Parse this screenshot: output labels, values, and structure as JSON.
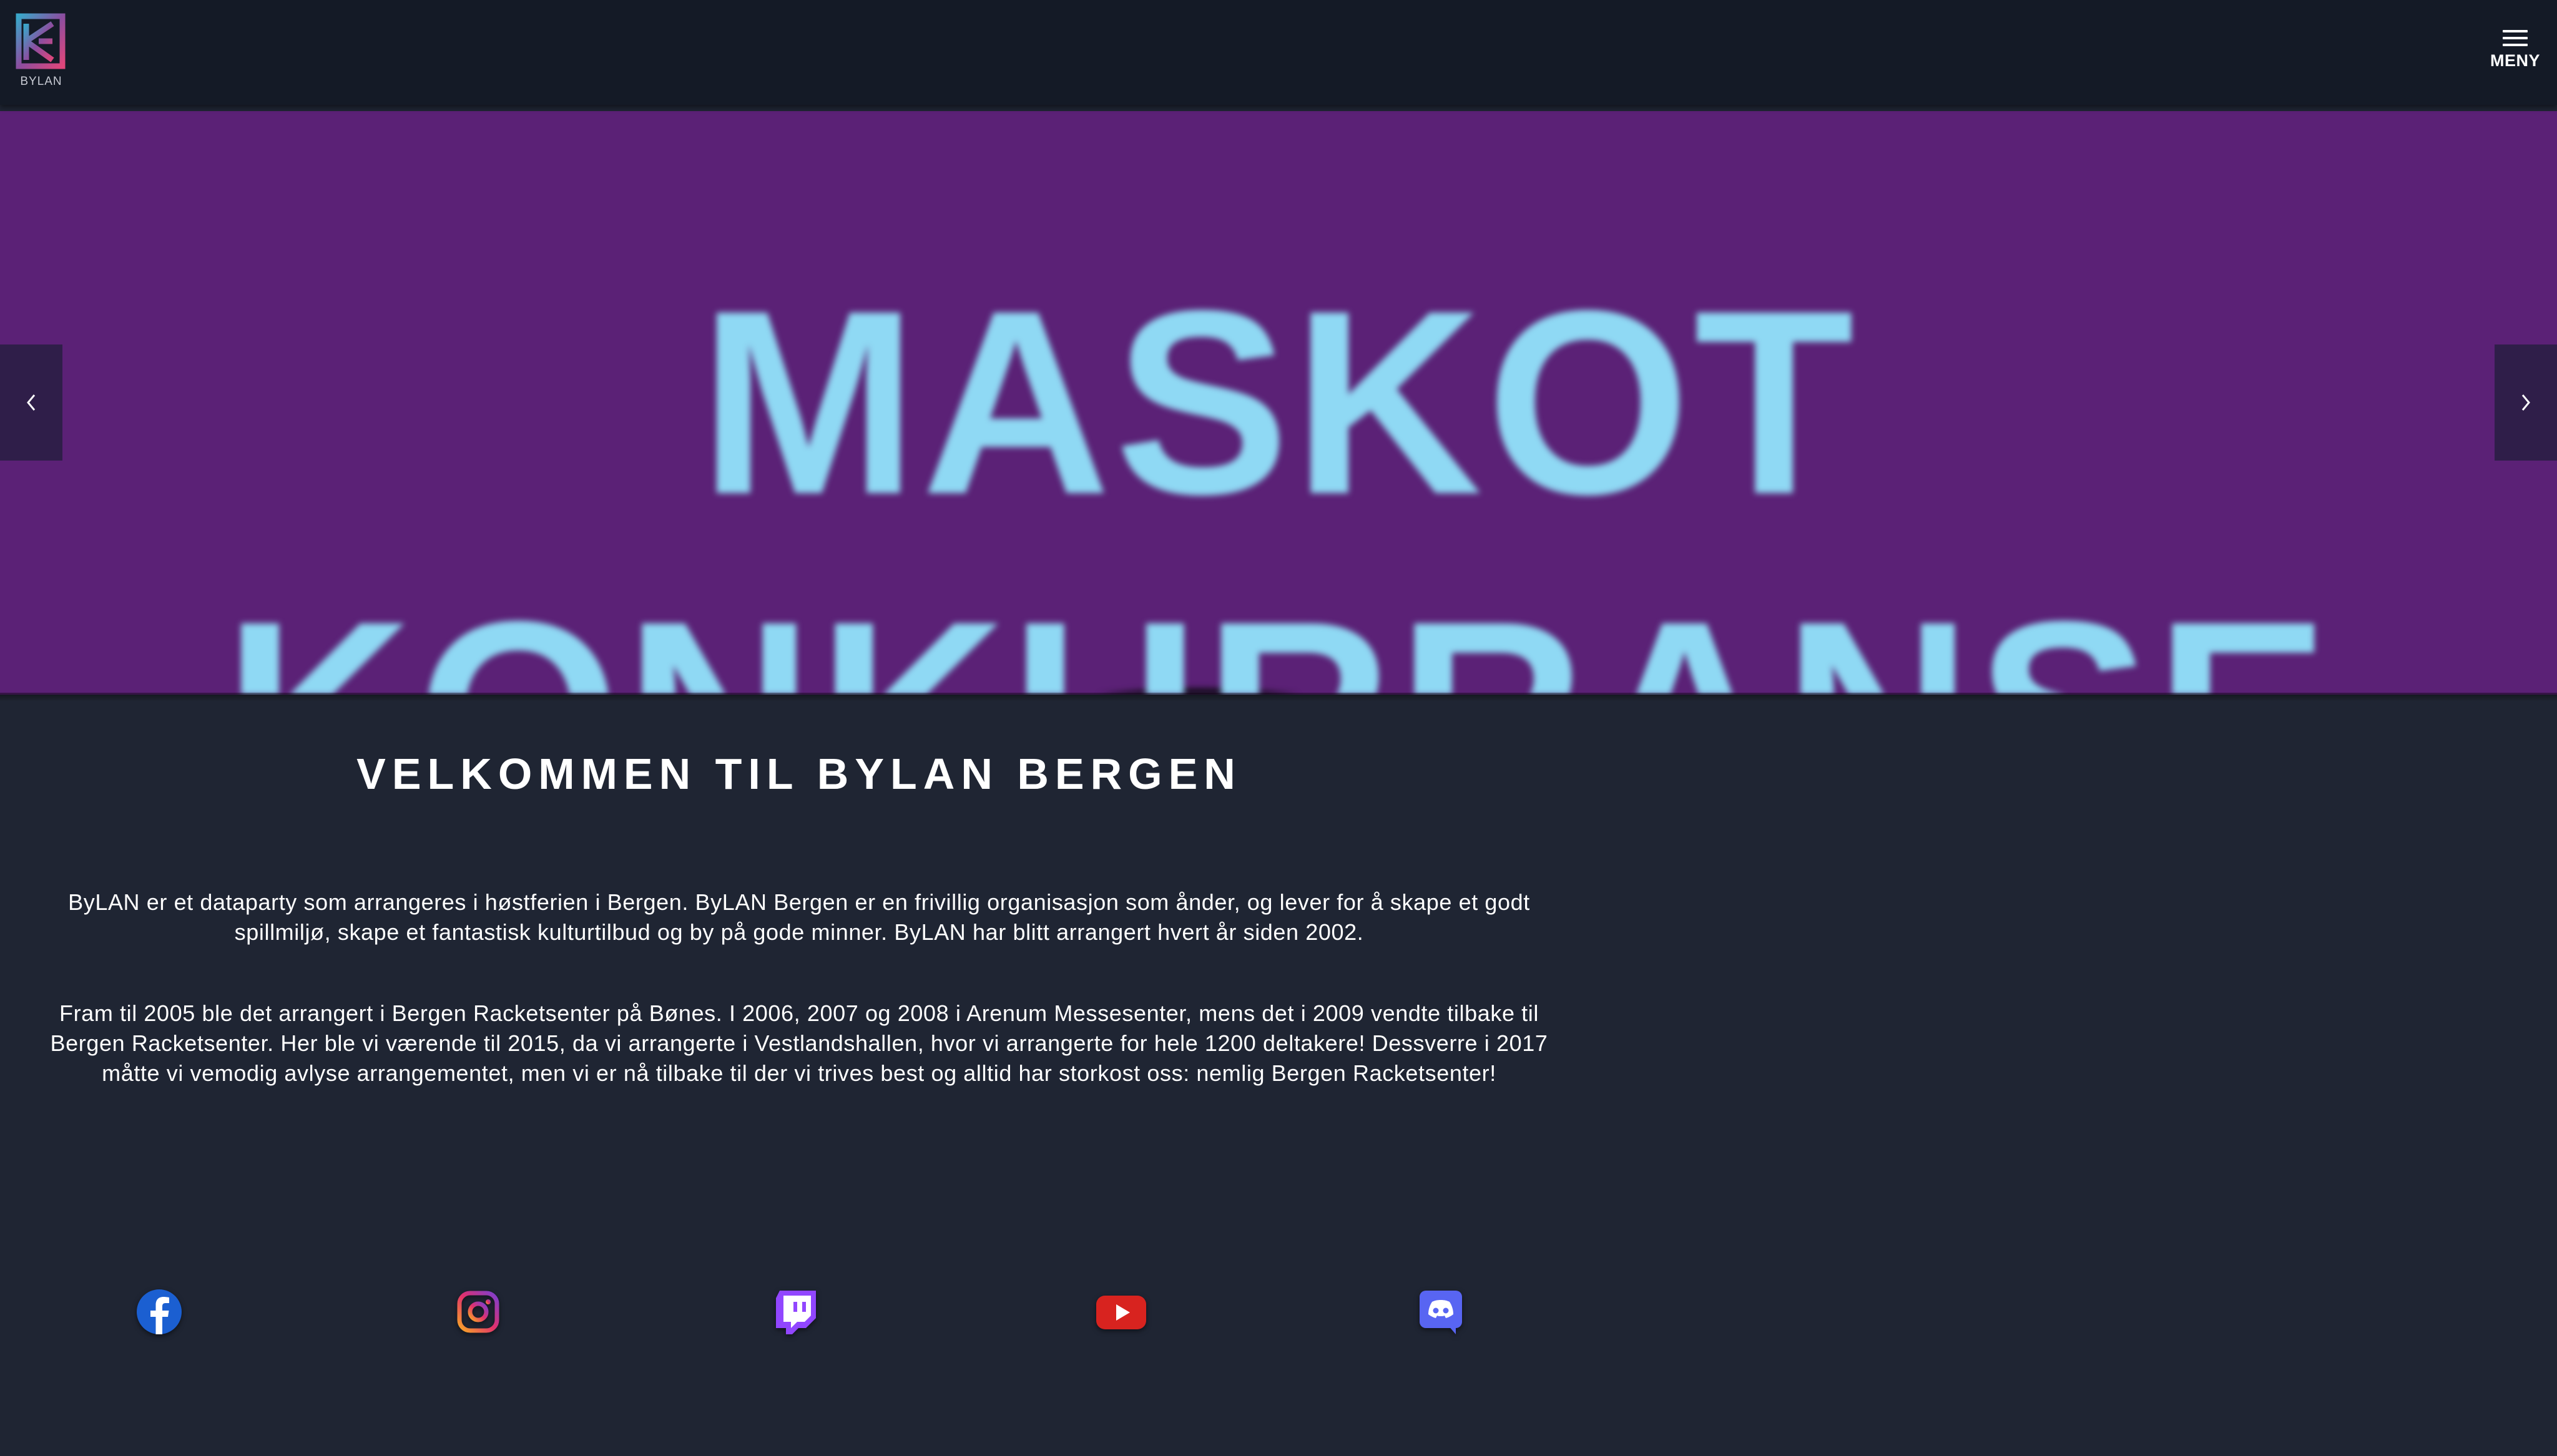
{
  "header": {
    "logo_text": "BYLAN",
    "menu_label": "MENY"
  },
  "hero": {
    "banner_line1": "MASKOT",
    "banner_line2": "KONKURRANSE",
    "colors": {
      "background": "#5b2176",
      "text": "#8fd9f4"
    }
  },
  "welcome": {
    "title": "VELKOMMEN TIL BYLAN BERGEN",
    "paragraph1": "ByLAN er et dataparty som arrangeres i høstferien i Bergen. ByLAN Bergen er en frivillig organisasjon som ånder, og lever for å skape et godt spillmiljø, skape et fantastisk kulturtilbud og by på gode minner. ByLAN har blitt arrangert hvert år siden 2002.",
    "paragraph2": "Fram til 2005 ble det arrangert i Bergen Racketsenter på Bønes. I 2006, 2007 og 2008 i Arenum Messesenter, mens det i 2009 vendte tilbake til Bergen Racketsenter. Her ble vi værende til 2015, da vi arrangerte i Vestlandshallen, hvor vi arrangerte for hele 1200 deltakere! Dessverre i 2017 måtte vi vemodig avlyse arrangementet, men vi er nå tilbake til der vi trives best og alltid har storkost oss: nemlig Bergen Racketsenter!"
  },
  "social": [
    {
      "name": "facebook-icon",
      "color": "#1877f2"
    },
    {
      "name": "instagram-icon",
      "color": "#e1306c"
    },
    {
      "name": "twitch-icon",
      "color": "#9146ff"
    },
    {
      "name": "youtube-icon",
      "color": "#e62117"
    },
    {
      "name": "discord-icon",
      "color": "#5865f2"
    }
  ],
  "colors": {
    "page_background": "#1f2533",
    "header_background": "#141a26"
  }
}
